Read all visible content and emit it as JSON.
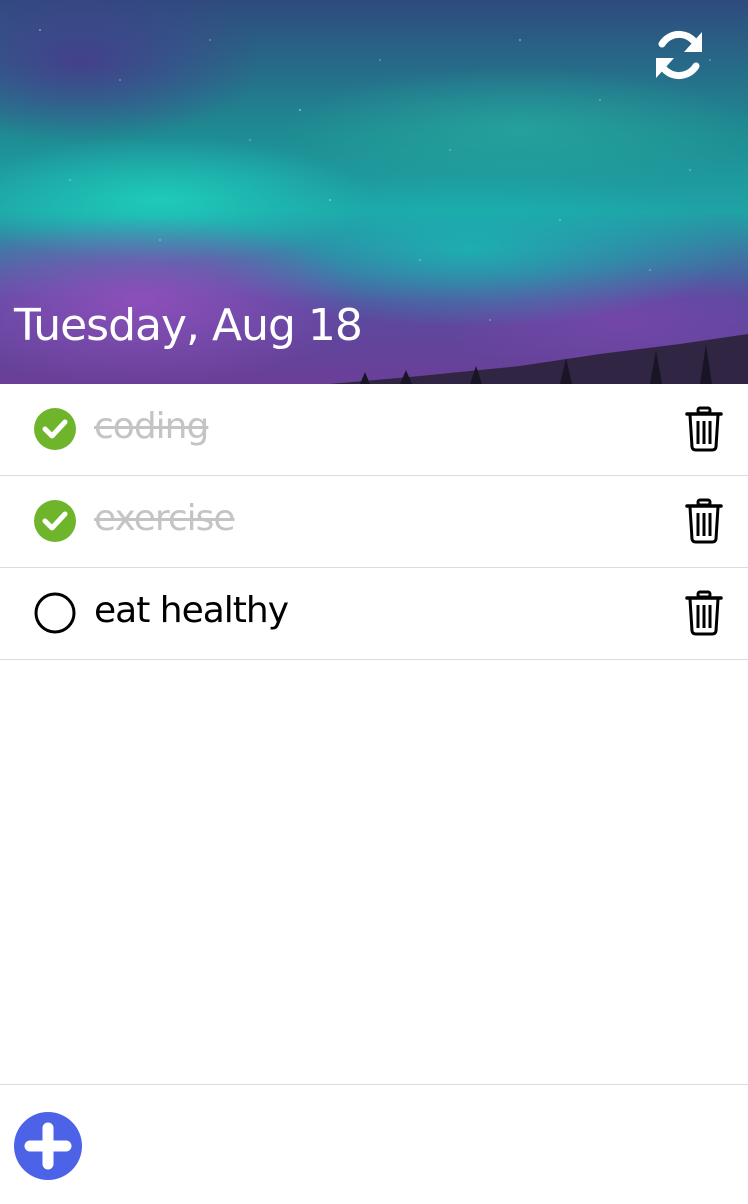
{
  "header": {
    "date": "Tuesday, Aug 18"
  },
  "tasks": [
    {
      "label": "coding",
      "completed": true
    },
    {
      "label": "exercise",
      "completed": true
    },
    {
      "label": "eat healthy",
      "completed": false
    }
  ],
  "icons": {
    "sync": "sync-icon",
    "check_done": "check-circle-icon",
    "check_open": "empty-circle-icon",
    "delete": "trash-icon",
    "add": "plus-circle-icon"
  },
  "colors": {
    "done_check": "#6fb52c",
    "done_text": "#c4c4c4",
    "add_button": "#4c63e8",
    "text": "#000000"
  }
}
